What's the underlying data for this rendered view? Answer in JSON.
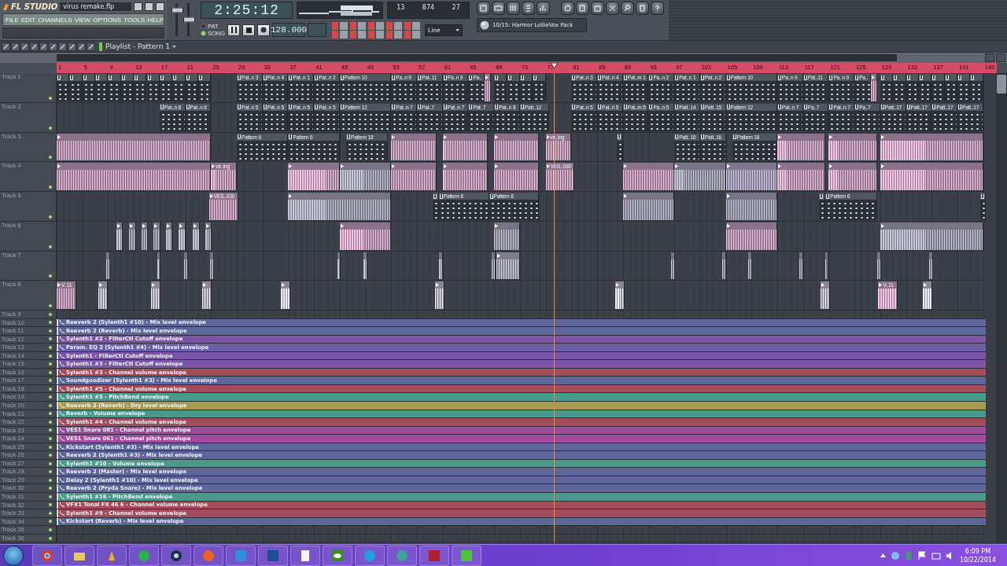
{
  "app": {
    "logo": "FL STUDIO",
    "file": "virus remake.flp",
    "menu": [
      "FILE",
      "EDIT",
      "CHANNELS",
      "VIEW",
      "OPTIONS",
      "TOOLS",
      "HELP"
    ]
  },
  "mixer_sliders": [
    {
      "level": 0.78
    },
    {
      "level": 0.5
    }
  ],
  "transport": {
    "time": "2:25:12",
    "modes": [
      {
        "label": "PAT",
        "selected": false
      },
      {
        "label": "SONG",
        "selected": true
      }
    ],
    "tempo": "128.000"
  },
  "cpu": {
    "values": [
      "13",
      "874",
      "27"
    ]
  },
  "snap": "Line",
  "browser_pack": "10/15: Harmor LollieVox Pack",
  "playlist": {
    "title": "Playlist - Pattern 1",
    "ruler": [
      "1",
      "5",
      "9",
      "13",
      "17",
      "21",
      "25",
      "29",
      "33",
      "37",
      "41",
      "45",
      "49",
      "53",
      "57",
      "61",
      "65",
      "69",
      "73",
      "77",
      "81",
      "85",
      "89",
      "93",
      "97",
      "101",
      "105",
      "109",
      "113",
      "117",
      "121",
      "125",
      "129",
      "133",
      "137",
      "141",
      "145"
    ],
    "playhead": {
      "level": 0.529
    },
    "tracks": [
      {
        "name": "Track 1",
        "clips": [
          {
            "kind": "pattern"
          },
          {
            "kind": "pattern"
          },
          {
            "kind": "pattern"
          },
          {
            "kind": "pattern"
          },
          {
            "kind": "pattern"
          },
          {
            "kind": "pattern"
          },
          {
            "kind": "pattern"
          },
          {
            "kind": "pattern"
          },
          {
            "kind": "pattern"
          },
          {
            "kind": "pattern"
          },
          {
            "kind": "pattern"
          },
          {
            "kind": "pattern"
          },
          {
            "kind": "pattern",
            "label": "Pat..n 3"
          },
          {
            "kind": "pattern",
            "label": "Pat..n 4"
          },
          {
            "kind": "pattern",
            "label": "Pat..n 1"
          },
          {
            "kind": "pattern",
            "label": "Pat..n 2"
          },
          {
            "kind": "pattern",
            "label": "Pattern 10"
          },
          {
            "kind": "pattern",
            "label": "Pa..n 9"
          },
          {
            "kind": "pattern",
            "label": "Pat..11"
          },
          {
            "kind": "pattern",
            "label": "Pa..n 9"
          },
          {
            "kind": "pattern",
            "label": "Pa.."
          },
          {
            "kind": "audio",
            "color": "#f2c4e4"
          },
          {
            "kind": "pattern"
          },
          {
            "kind": "pattern"
          },
          {
            "kind": "pattern"
          },
          {
            "kind": "pattern"
          },
          {
            "kind": "pattern",
            "label": "Pat..n 3"
          },
          {
            "kind": "pattern",
            "label": "Pat..n 4"
          },
          {
            "kind": "pattern",
            "label": "Pat..m 1"
          },
          {
            "kind": "pattern",
            "label": "Pa..n 2"
          },
          {
            "kind": "pattern",
            "label": "Pat..n 1"
          },
          {
            "kind": "pattern",
            "label": "Pat..n 2"
          },
          {
            "kind": "pattern",
            "label": "Pattern 10"
          },
          {
            "kind": "pattern",
            "label": "Pa..n 9"
          },
          {
            "kind": "pattern",
            "label": "Pat..11"
          },
          {
            "kind": "pattern",
            "label": "Pa..n 9"
          },
          {
            "kind": "pattern",
            "label": "Pa.."
          },
          {
            "kind": "audio",
            "color": "#f2c4e4"
          },
          {
            "kind": "pattern"
          },
          {
            "kind": "pattern"
          },
          {
            "kind": "pattern"
          },
          {
            "kind": "pattern"
          },
          {
            "kind": "pattern"
          },
          {
            "kind": "pattern"
          },
          {
            "kind": "pattern"
          },
          {
            "kind": "pattern"
          }
        ]
      },
      {
        "name": "Track 2",
        "clips": [
          {
            "kind": "pattern",
            "label": "Pat..n 8"
          },
          {
            "kind": "pattern",
            "label": "Pat..n 8"
          },
          {
            "kind": "pattern",
            "label": "Pat..n 5"
          },
          {
            "kind": "pattern",
            "label": "Pat..n 5"
          },
          {
            "kind": "pattern",
            "label": "Pat..n 5"
          },
          {
            "kind": "pattern",
            "label": "Pat..n 5"
          },
          {
            "kind": "pattern",
            "label": "Pattern 12"
          },
          {
            "kind": "pattern",
            "label": "Pat..n 7"
          },
          {
            "kind": "pattern",
            "label": "Pat..7"
          },
          {
            "kind": "pattern",
            "label": "Pat..n 7"
          },
          {
            "kind": "pattern",
            "label": "Pat..7"
          },
          {
            "kind": "pattern",
            "label": "Pat..n 8"
          },
          {
            "kind": "pattern",
            "label": "Patt..12"
          },
          {
            "kind": "pattern",
            "label": "Pat..n 5"
          },
          {
            "kind": "pattern",
            "label": "Pat..n 5"
          },
          {
            "kind": "pattern",
            "label": "Pat..m 5"
          },
          {
            "kind": "pattern",
            "label": "Pa..n 5"
          },
          {
            "kind": "pattern",
            "label": "Patt..14"
          },
          {
            "kind": "pattern",
            "label": "Patt..15"
          },
          {
            "kind": "pattern",
            "label": "Pattern 12"
          },
          {
            "kind": "pattern",
            "label": "Pat..n 7"
          },
          {
            "kind": "pattern",
            "label": "Pa..7"
          },
          {
            "kind": "pattern",
            "label": "Pat..n 7"
          },
          {
            "kind": "pattern",
            "label": "Pa..7"
          },
          {
            "kind": "pattern",
            "label": "Patt..17"
          },
          {
            "kind": "pattern",
            "label": "Patt..17"
          },
          {
            "kind": "pattern",
            "label": "Patt..17"
          },
          {
            "kind": "pattern",
            "label": "Patt..17"
          }
        ]
      },
      {
        "name": "Track 3",
        "clips": [
          {
            "kind": "audio",
            "color": "#f2c4e4"
          },
          {
            "kind": "pattern",
            "label": "Pattern 6"
          },
          {
            "kind": "pattern",
            "label": "Pattern 6"
          },
          {
            "kind": "pattern",
            "label": "Pattern 18"
          },
          {
            "kind": "audio",
            "color": "#f2c4e4"
          },
          {
            "kind": "audio",
            "color": "#f2c4e4"
          },
          {
            "kind": "audio",
            "color": "#f2c4e4"
          },
          {
            "kind": "audio",
            "label": "vir..ing",
            "color": "#f2c4e4"
          },
          {
            "kind": "pattern"
          },
          {
            "kind": "pattern",
            "label": "Patt..16"
          },
          {
            "kind": "pattern",
            "label": "Patt..16"
          },
          {
            "kind": "pattern",
            "label": "Pattern 18"
          },
          {
            "kind": "audio",
            "color": "#f2c4e4"
          },
          {
            "kind": "audio",
            "color": "#f2c4e4"
          },
          {
            "kind": "audio",
            "color": "#f2c4e4"
          }
        ]
      },
      {
        "name": "Track 4",
        "clips": [
          {
            "kind": "audio",
            "color": "#f2c4e4"
          },
          {
            "kind": "audio",
            "label": "vir..ing",
            "color": "#f2c4e4"
          },
          {
            "kind": "audio",
            "color": "#f2c4e4"
          },
          {
            "kind": "audio",
            "color": "#c4c8d6"
          },
          {
            "kind": "audio",
            "color": "#f2c4e4"
          },
          {
            "kind": "audio",
            "color": "#f2c4e4"
          },
          {
            "kind": "audio",
            "color": "#f2c4e4"
          },
          {
            "kind": "audio",
            "label": "VES..030",
            "color": "#f2c4e4"
          },
          {
            "kind": "audio",
            "color": "#f2c4e4"
          },
          {
            "kind": "audio",
            "color": "#c4c8d6"
          },
          {
            "kind": "audio",
            "color": "#d4d0ee"
          },
          {
            "kind": "audio",
            "color": "#f2c4e4"
          },
          {
            "kind": "audio",
            "color": "#f2c4e4"
          },
          {
            "kind": "audio",
            "color": "#f2c4e4"
          }
        ]
      },
      {
        "name": "Track 5",
        "clips": [
          {
            "kind": "audio",
            "label": "VES..030",
            "color": "#f2c4e4"
          },
          {
            "kind": "audio",
            "color": "#c4c8d6"
          },
          {
            "kind": "pattern"
          },
          {
            "kind": "pattern",
            "label": "Pattern 6"
          },
          {
            "kind": "pattern",
            "label": "Pattern 6"
          },
          {
            "kind": "audio",
            "color": "#c4c8d6"
          },
          {
            "kind": "audio",
            "color": "#c4c8d6"
          },
          {
            "kind": "pattern"
          },
          {
            "kind": "pattern",
            "label": "Pattern 6"
          },
          {
            "kind": "pattern"
          }
        ]
      },
      {
        "name": "Track 6",
        "clips": [
          {
            "kind": "audio",
            "color": "#c4c8d6"
          },
          {
            "kind": "audio",
            "color": "#c4c8d6"
          },
          {
            "kind": "audio",
            "color": "#c4c8d6"
          },
          {
            "kind": "audio",
            "color": "#c4c8d6"
          },
          {
            "kind": "audio",
            "color": "#c4c8d6"
          },
          {
            "kind": "audio",
            "color": "#c4c8d6"
          },
          {
            "kind": "audio",
            "color": "#c4c8d6"
          },
          {
            "kind": "audio",
            "color": "#c4c8d6"
          },
          {
            "kind": "audio",
            "color": "#f2c4e4"
          },
          {
            "kind": "audio",
            "color": "#c4c8d6"
          },
          {
            "kind": "audio",
            "color": "#f2c4e4"
          },
          {
            "kind": "audio",
            "color": "#c4c8d6"
          }
        ]
      },
      {
        "name": "Track 7",
        "clips": [
          {
            "kind": "audio",
            "color": "#c4c8d6"
          },
          {
            "kind": "audio",
            "color": "#c4c8d6"
          },
          {
            "kind": "audio",
            "color": "#c4c8d6"
          },
          {
            "kind": "audio",
            "color": "#c4c8d6"
          },
          {
            "kind": "audio",
            "color": "#c4c8d6"
          },
          {
            "kind": "audio",
            "color": "#c4c8d6"
          },
          {
            "kind": "audio",
            "color": "#c4c8d6"
          },
          {
            "kind": "audio",
            "color": "#c4c8d6"
          },
          {
            "kind": "audio",
            "color": "#d4d8e6"
          },
          {
            "kind": "audio",
            "color": "#c4c8d6"
          },
          {
            "kind": "audio",
            "color": "#c4c8d6"
          },
          {
            "kind": "audio",
            "color": "#c4c8d6"
          },
          {
            "kind": "audio",
            "color": "#c4c8d6"
          },
          {
            "kind": "audio",
            "color": "#c4c8d6"
          },
          {
            "kind": "audio",
            "color": "#c4c8d6"
          },
          {
            "kind": "audio",
            "color": "#c4c8d6"
          }
        ]
      },
      {
        "name": "Track 8",
        "clips": [
          {
            "kind": "audio",
            "label": "V..11",
            "color": "#f2c4e4"
          },
          {
            "kind": "audio",
            "color": "#eef0f4"
          },
          {
            "kind": "audio",
            "color": "#eef0f4"
          },
          {
            "kind": "audio",
            "color": "#eef0f4"
          },
          {
            "kind": "audio",
            "color": "#eef0f4"
          },
          {
            "kind": "audio",
            "color": "#eef0f4"
          },
          {
            "kind": "audio",
            "color": "#eef0f4"
          },
          {
            "kind": "audio",
            "color": "#eef0f4"
          },
          {
            "kind": "audio",
            "label": "V..11",
            "color": "#f2c4e4"
          },
          {
            "kind": "audio",
            "color": "#eef0f4"
          }
        ]
      },
      {
        "name": "Track 9"
      },
      {
        "name": "Track 10",
        "clips": [
          {
            "kind": "automation",
            "label": "Reeverb 2 (Sylenth1 #10) - Mix level envelope",
            "color": "#5c6699"
          }
        ]
      },
      {
        "name": "Track 11",
        "clips": [
          {
            "kind": "automation",
            "label": "Reeverb 2 (Reverb) - Mix level envelope",
            "color": "#5c6699"
          }
        ]
      },
      {
        "name": "Track 12",
        "clips": [
          {
            "kind": "automation",
            "label": "Sylenth1 #2 - FilterCtl Cutoff envelope",
            "color": "#7b55a8"
          }
        ]
      },
      {
        "name": "Track 13",
        "clips": [
          {
            "kind": "automation",
            "label": "Param. EQ 2 (Sylenth1 #4) - Mix level envelope",
            "color": "#6a5ea6"
          }
        ]
      },
      {
        "name": "Track 14",
        "clips": [
          {
            "kind": "automation",
            "label": "Sylenth1 - FilterCtl Cutoff envelope",
            "color": "#7b55a8"
          }
        ]
      },
      {
        "name": "Track 15",
        "clips": [
          {
            "kind": "automation",
            "label": "Sylenth1 #3 - FilterCtl Cutoff envelope",
            "color": "#7b55a8"
          }
        ]
      },
      {
        "name": "Track 16",
        "clips": [
          {
            "kind": "automation",
            "label": "Sylenth1 #3 - Channel volume envelope",
            "color": "#a34d5c"
          }
        ]
      },
      {
        "name": "Track 17",
        "clips": [
          {
            "kind": "automation",
            "label": "Soundgoodizer (Sylenth1 #3) - Mix level envelope",
            "color": "#5c6699"
          }
        ]
      },
      {
        "name": "Track 18",
        "clips": [
          {
            "kind": "automation",
            "label": "Sylenth1 #5 - Channel volume envelope",
            "color": "#a34d5c"
          }
        ]
      },
      {
        "name": "Track 19",
        "clips": [
          {
            "kind": "automation",
            "label": "Sylenth1 #5 - PitchBend envelope",
            "color": "#4a9a8c"
          }
        ]
      },
      {
        "name": "Track 20",
        "clips": [
          {
            "kind": "automation",
            "label": "Reeverb 2 (Reverb) - Dry level envelope",
            "color": "#a89a52"
          }
        ]
      },
      {
        "name": "Track 21",
        "clips": [
          {
            "kind": "automation",
            "label": "Reverb - Volume envelope",
            "color": "#4a9a8c"
          }
        ]
      },
      {
        "name": "Track 22",
        "clips": [
          {
            "kind": "automation",
            "label": "Sylenth1 #4 - Channel volume envelope",
            "color": "#a34d5c"
          }
        ]
      },
      {
        "name": "Track 23",
        "clips": [
          {
            "kind": "automation",
            "label": "VES1 Snare 081 - Channel pitch envelope",
            "color": "#a04c9e"
          }
        ]
      },
      {
        "name": "Track 24",
        "clips": [
          {
            "kind": "automation",
            "label": "VES1 Snare 061 - Channel pitch envelope",
            "color": "#a04c9e"
          }
        ]
      },
      {
        "name": "Track 25",
        "clips": [
          {
            "kind": "automation",
            "label": "Kickstart (Sylenth1 #3) - Mix level envelope",
            "color": "#5c6699"
          }
        ]
      },
      {
        "name": "Track 26",
        "clips": [
          {
            "kind": "automation",
            "label": "Reeverb 2 (Sylenth1 #3) - Mix level envelope",
            "color": "#5c6699"
          }
        ]
      },
      {
        "name": "Track 27",
        "clips": [
          {
            "kind": "automation",
            "label": "Sylenth1 #10 - Volume envelope",
            "color": "#4a9a8c"
          }
        ]
      },
      {
        "name": "Track 28",
        "clips": [
          {
            "kind": "automation",
            "label": "Reeverb 2 (Master) - Mix level envelope",
            "color": "#5c6699"
          }
        ]
      },
      {
        "name": "Track 29",
        "clips": [
          {
            "kind": "automation",
            "label": "Delay 2 (Sylenth1 #10) - Mix level envelope",
            "color": "#5c6699"
          }
        ]
      },
      {
        "name": "Track 30",
        "clips": [
          {
            "kind": "automation",
            "label": "Reeverb 2 (Pryda Snare) - Mix level envelope",
            "color": "#5c6699"
          }
        ]
      },
      {
        "name": "Track 31",
        "clips": [
          {
            "kind": "automation",
            "label": "Sylenth1 #16 - PitchBend envelope",
            "color": "#4a9a8c"
          }
        ]
      },
      {
        "name": "Track 32",
        "clips": [
          {
            "kind": "automation",
            "label": "VFX1 Tonal FX 46 6 - Channel volume envelope",
            "color": "#a34d5c"
          }
        ]
      },
      {
        "name": "Track 33",
        "clips": [
          {
            "kind": "automation",
            "label": "Sylenth1 #9 - Channel volume envelope",
            "color": "#a34d5c"
          }
        ]
      },
      {
        "name": "Track 34",
        "clips": [
          {
            "kind": "automation",
            "label": "Kickstart (Reverb) - Mix level envelope",
            "color": "#5c6699"
          }
        ]
      },
      {
        "name": "Track 35"
      },
      {
        "name": "Track 36"
      }
    ]
  },
  "taskbar": {
    "time": "6:09 PM",
    "date": "10/22/2014"
  }
}
